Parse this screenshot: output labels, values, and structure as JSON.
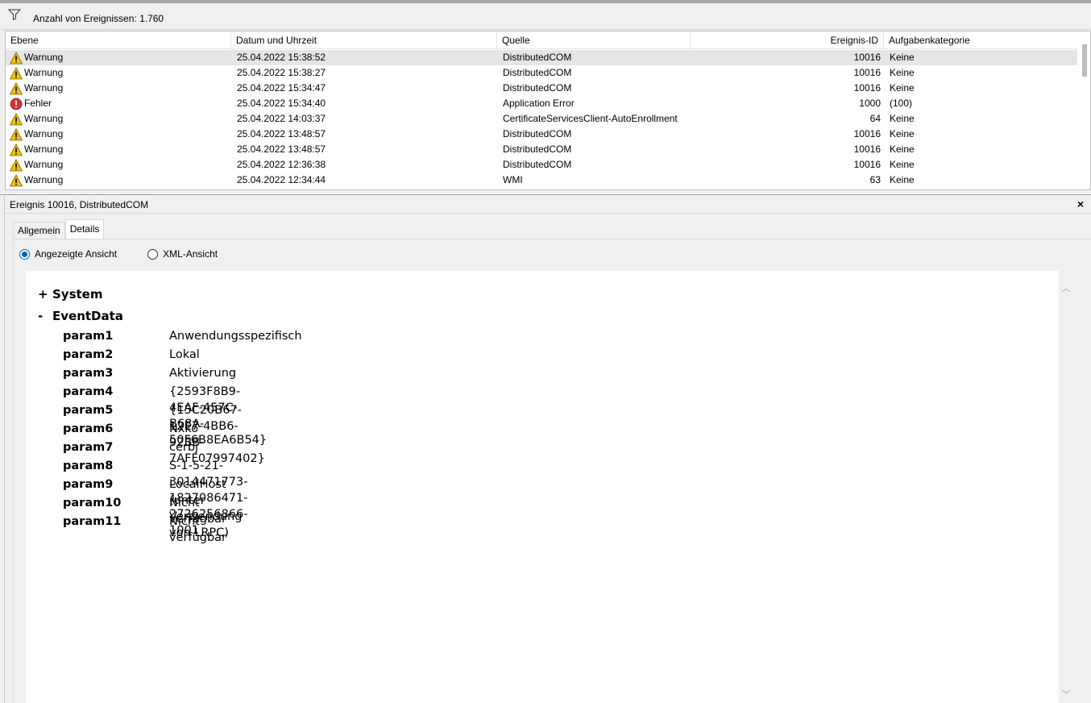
{
  "filter": {
    "icon": "filter-icon",
    "count_text": "Anzahl von Ereignissen: 1.760"
  },
  "table": {
    "columns": [
      "Ebene",
      "Datum und Uhrzeit",
      "Quelle",
      "Ereignis-ID",
      "Aufgabenkategorie"
    ],
    "rows": [
      {
        "level": "Warnung",
        "icon": "warning-icon",
        "date": "25.04.2022 15:38:52",
        "source": "DistributedCOM",
        "id": "10016",
        "category": "Keine"
      },
      {
        "level": "Warnung",
        "icon": "warning-icon",
        "date": "25.04.2022 15:38:27",
        "source": "DistributedCOM",
        "id": "10016",
        "category": "Keine"
      },
      {
        "level": "Warnung",
        "icon": "warning-icon",
        "date": "25.04.2022 15:34:47",
        "source": "DistributedCOM",
        "id": "10016",
        "category": "Keine"
      },
      {
        "level": "Fehler",
        "icon": "error-icon",
        "date": "25.04.2022 15:34:40",
        "source": "Application Error",
        "id": "1000",
        "category": "(100)"
      },
      {
        "level": "Warnung",
        "icon": "warning-icon",
        "date": "25.04.2022 14:03:37",
        "source": "CertificateServicesClient-AutoEnrollment",
        "id": "64",
        "category": "Keine"
      },
      {
        "level": "Warnung",
        "icon": "warning-icon",
        "date": "25.04.2022 13:48:57",
        "source": "DistributedCOM",
        "id": "10016",
        "category": "Keine"
      },
      {
        "level": "Warnung",
        "icon": "warning-icon",
        "date": "25.04.2022 13:48:57",
        "source": "DistributedCOM",
        "id": "10016",
        "category": "Keine"
      },
      {
        "level": "Warnung",
        "icon": "warning-icon",
        "date": "25.04.2022 12:36:38",
        "source": "DistributedCOM",
        "id": "10016",
        "category": "Keine"
      },
      {
        "level": "Warnung",
        "icon": "warning-icon",
        "date": "25.04.2022 12:34:44",
        "source": "WMI",
        "id": "63",
        "category": "Keine"
      }
    ]
  },
  "details": {
    "title": "Ereignis 10016, DistributedCOM",
    "close_label": "×",
    "tabs": [
      "Allgemein",
      "Details"
    ],
    "view_options": {
      "friendly": "Angezeigte Ansicht",
      "xml": "XML-Ansicht"
    },
    "system": {
      "sign": "+",
      "label": "System"
    },
    "eventdata": {
      "sign": "-",
      "label": "EventData"
    },
    "params": [
      {
        "key": "param1",
        "value": "Anwendungsspezifisch"
      },
      {
        "key": "param2",
        "value": "Lokal"
      },
      {
        "key": "param3",
        "value": "Aktivierung"
      },
      {
        "key": "param4",
        "value": "{2593F8B9-4EAF-457C-B68A-50F6B8EA6B54}"
      },
      {
        "key": "param5",
        "value": "{15C20B67-12E7-4BB6-92BB-7AFF07997402}"
      },
      {
        "key": "param6",
        "value": "Nxko"
      },
      {
        "key": "param7",
        "value": "cerbj"
      },
      {
        "key": "param8",
        "value": "S-1-5-21-3014471773-1827086471-2726256866-1001"
      },
      {
        "key": "param9",
        "value": "LocalHost (unter Verwendung von LRPC)"
      },
      {
        "key": "param10",
        "value": "Nicht verfügbar"
      },
      {
        "key": "param11",
        "value": "Nicht verfügbar"
      }
    ]
  },
  "colors": {
    "selected_row": "#e5e5e5",
    "radio_accent": "#0063b1",
    "warning": "#f2c200",
    "error": "#d13438"
  }
}
